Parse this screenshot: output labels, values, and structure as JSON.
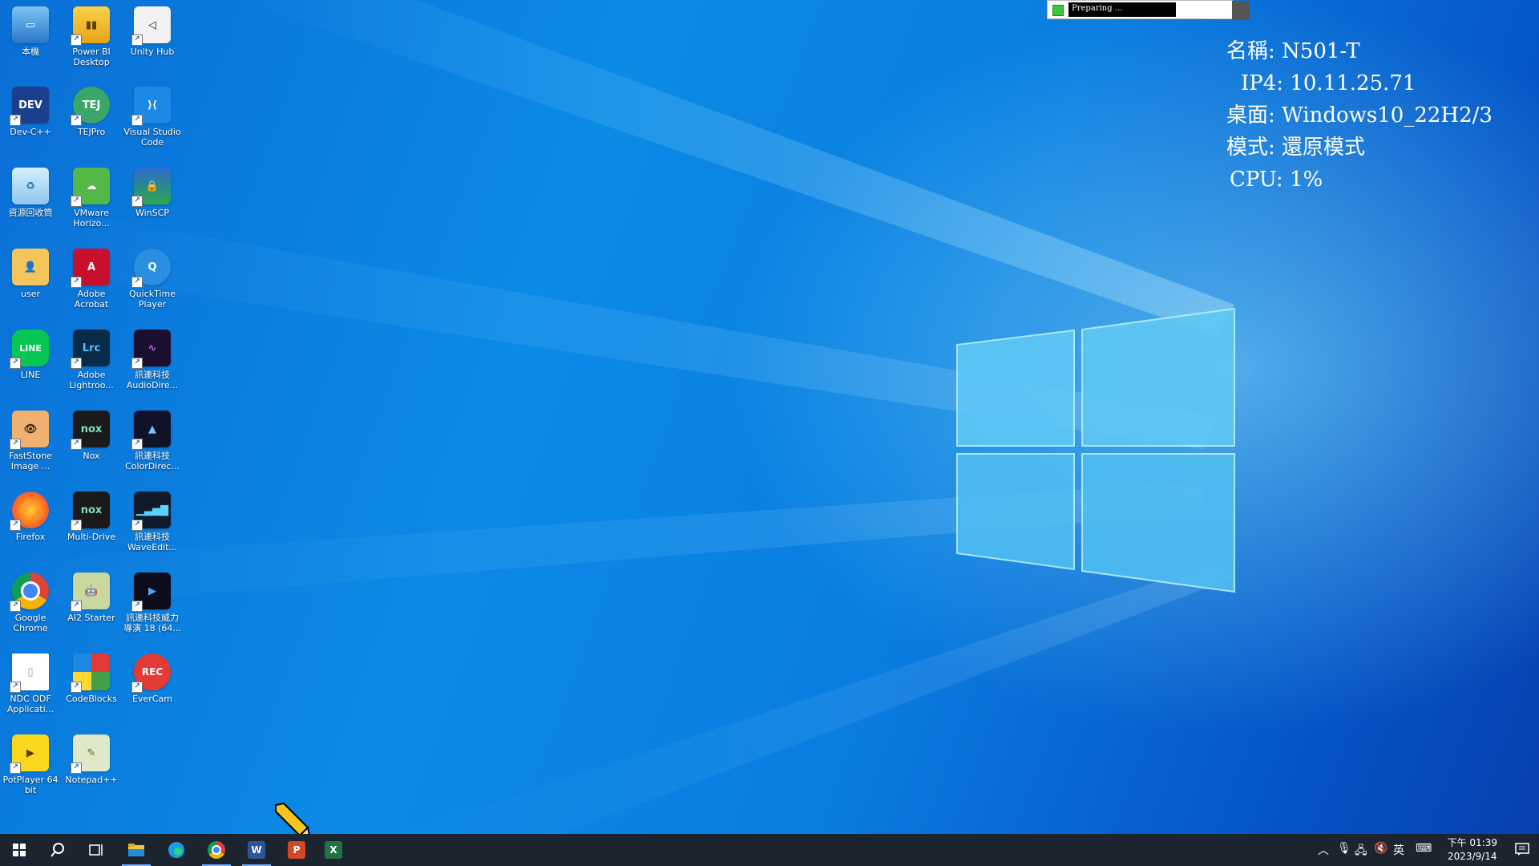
{
  "desktop": {
    "icons": [
      {
        "label": "本機",
        "icon": "computer-icon"
      },
      {
        "label": "Power BI Desktop",
        "icon": "powerbi-icon"
      },
      {
        "label": "Unity Hub",
        "icon": "unity-icon"
      },
      {
        "label": "Dev-C++",
        "icon": "devcpp-icon"
      },
      {
        "label": "TEJPro",
        "icon": "tejpro-icon"
      },
      {
        "label": "Visual Studio Code",
        "icon": "vscode-icon"
      },
      {
        "label": "資源回收筒",
        "icon": "recycle-bin-icon"
      },
      {
        "label": "VMware Horizo...",
        "icon": "vmware-icon"
      },
      {
        "label": "WinSCP",
        "icon": "winscp-icon"
      },
      {
        "label": "user",
        "icon": "user-folder-icon"
      },
      {
        "label": "Adobe Acrobat",
        "icon": "acrobat-icon"
      },
      {
        "label": "QuickTime Player",
        "icon": "quicktime-icon"
      },
      {
        "label": "LINE",
        "icon": "line-icon"
      },
      {
        "label": "Adobe Lightroo...",
        "icon": "lightroom-icon"
      },
      {
        "label": "訊連科技 AudioDire...",
        "icon": "audiodirector-icon"
      },
      {
        "label": "FastStone Image ...",
        "icon": "faststone-icon"
      },
      {
        "label": "Nox",
        "icon": "nox-icon"
      },
      {
        "label": "訊連科技 ColorDirec...",
        "icon": "colordirector-icon"
      },
      {
        "label": "Firefox",
        "icon": "firefox-icon"
      },
      {
        "label": "Multi-Drive",
        "icon": "multidrive-icon"
      },
      {
        "label": "訊連科技 WaveEdit...",
        "icon": "waveeditor-icon"
      },
      {
        "label": "Google Chrome",
        "icon": "chrome-icon"
      },
      {
        "label": "AI2 Starter",
        "icon": "ai2-icon"
      },
      {
        "label": "訊連科技威力導演 18 (64...",
        "icon": "powerdirector-icon"
      },
      {
        "label": "NDC ODF Applicati...",
        "icon": "document-icon"
      },
      {
        "label": "CodeBlocks",
        "icon": "codeblocks-icon"
      },
      {
        "label": "EverCam",
        "icon": "evercam-icon"
      },
      {
        "label": "PotPlayer 64 bit",
        "icon": "potplayer-icon"
      },
      {
        "label": "Notepad++",
        "icon": "notepadpp-icon"
      }
    ]
  },
  "info": {
    "name_label": "名稱:",
    "name_value": "N501-T",
    "ip_label": "IP4:",
    "ip_value": "10.11.25.71",
    "desktop_label": "桌面:",
    "desktop_value": "Windows10_22H2/3",
    "mode_label": "模式:",
    "mode_value": "還原模式",
    "cpu_label": "CPU:",
    "cpu_value": "1%"
  },
  "preparing": {
    "text": "Preparing ..."
  },
  "colors": {
    "accent": "#0a7de0",
    "taskbar": "#1c2430"
  },
  "taskbar": {
    "apps": [
      {
        "name": "start",
        "icon": "windows-start-icon"
      },
      {
        "name": "search",
        "icon": "search-icon"
      },
      {
        "name": "task-view",
        "icon": "task-view-icon"
      },
      {
        "name": "file-explorer",
        "icon": "folder-icon"
      },
      {
        "name": "edge",
        "icon": "edge-icon"
      },
      {
        "name": "chrome",
        "icon": "chrome-icon"
      },
      {
        "name": "word",
        "icon": "word-icon"
      },
      {
        "name": "powerpoint",
        "icon": "powerpoint-icon"
      },
      {
        "name": "excel",
        "icon": "excel-icon"
      }
    ],
    "tray": {
      "ime": "英",
      "time": "下午 01:39",
      "date": "2023/9/14"
    }
  }
}
